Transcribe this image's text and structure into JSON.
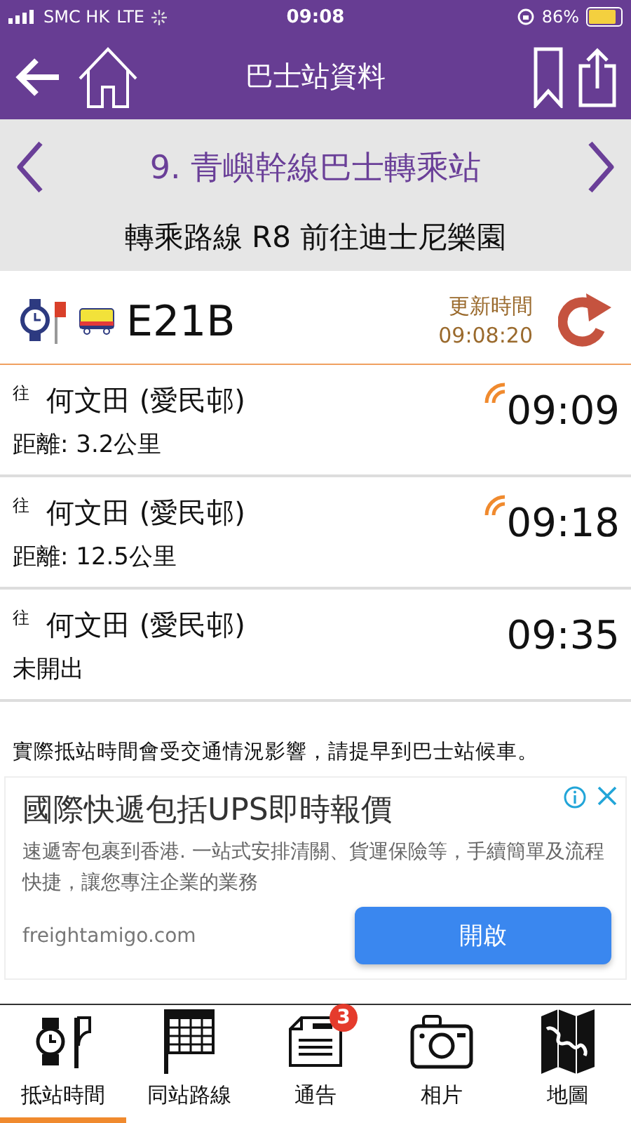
{
  "status_bar": {
    "carrier": "SMC HK",
    "network": "LTE",
    "time": "09:08",
    "battery": "86%"
  },
  "nav": {
    "title": "巴士站資料"
  },
  "station": {
    "name": "9. 青嶼幹線巴士轉乘站"
  },
  "transfer_title": "轉乘路線 R8 前往迪士尼樂園",
  "route": {
    "number": "E21B",
    "updated_label": "更新時間",
    "updated_time": "09:08:20"
  },
  "arrivals": [
    {
      "prefix": "往",
      "destination": "何文田 (愛民邨)",
      "detail": "距離: 3.2公里",
      "time": "09:09",
      "realtime": true
    },
    {
      "prefix": "往",
      "destination": "何文田 (愛民邨)",
      "detail": "距離: 12.5公里",
      "time": "09:18",
      "realtime": true
    },
    {
      "prefix": "往",
      "destination": "何文田 (愛民邨)",
      "detail": "未開出",
      "time": "09:35",
      "realtime": false
    }
  ],
  "notice": "實際抵站時間會受交通情況影響，請提早到巴士站候車。",
  "ad": {
    "headline": "國際快遞包括UPS即時報價",
    "body": "速遞寄包裹到香港. 一站式安排清關、貨運保險等，手續簡單及流程快捷，讓您專注企業的業務",
    "domain": "freightamigo.com",
    "button": "開啟"
  },
  "tabs": [
    {
      "label": "抵站時間",
      "kind": "eta",
      "selected": true
    },
    {
      "label": "同站路線",
      "kind": "routes",
      "selected": false
    },
    {
      "label": "通告",
      "kind": "notice",
      "selected": false,
      "badge": "3"
    },
    {
      "label": "相片",
      "kind": "photo",
      "selected": false
    },
    {
      "label": "地圖",
      "kind": "map",
      "selected": false
    }
  ]
}
